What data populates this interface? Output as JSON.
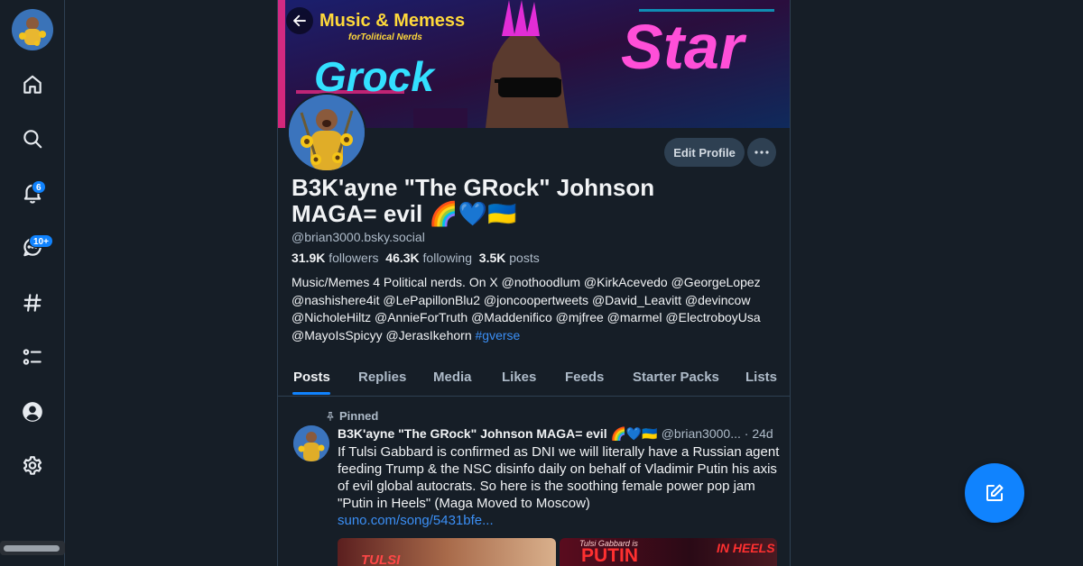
{
  "nav": {
    "notifications_badge": "6",
    "messages_badge": "10+"
  },
  "banner": {
    "title": "Music & Memess",
    "subtitle": "forTolitical Nerds",
    "word_left": "Grock",
    "word_right": "Star"
  },
  "profile": {
    "edit_label": "Edit Profile",
    "display_name": "B3K'ayne \"The GRock\" Johnson MAGA= evil 🌈💙🇺🇦",
    "handle": "@brian3000.bsky.social",
    "followers_count": "31.9K",
    "followers_label": "followers",
    "following_count": "46.3K",
    "following_label": "following",
    "posts_count": "3.5K",
    "posts_label": "posts",
    "bio_text": "Music/Memes 4 Political nerds. On X @nothoodlum @KirkAcevedo @GeorgeLopez @nashishere4it @LePapillonBlu2 @joncoopertweets @David_Leavitt @devincow @NicholeHiltz @AnnieForTruth @Maddenifico @mjfree @marmel @ElectroboyUsa @MayoIsSpicyy @JerasIkehorn",
    "bio_tag": "#gverse"
  },
  "tabs": [
    "Posts",
    "Replies",
    "Media",
    "Likes",
    "Feeds",
    "Starter Packs",
    "Lists"
  ],
  "post": {
    "pinned_label": "Pinned",
    "author_name": "B3K'ayne \"The GRock\" Johnson MAGA= evil 🌈💙🇺🇦",
    "author_handle": "@brian3000...",
    "sep": "·",
    "age": "24d",
    "text": "If Tulsi Gabbard is confirmed as DNI we will literally have a Russian agent feeding Trump & the NSC disinfo daily on behalf of Vladimir Putin his axis of evil global autocrats.  So here is the soothing female power pop jam \"Putin in Heels\" (Maga Moved to Moscow)",
    "link": "suno.com/song/5431bfe...",
    "image_left_text": "TULSI",
    "image_right_small": "Tulsi Gabbard is",
    "image_right_big": "PUTIN",
    "image_right_tag": "IN HEELS"
  },
  "colors": {
    "background": "#161e27",
    "accent": "#1083fe",
    "border": "#2e4052",
    "muted_text": "#aebbc9"
  }
}
